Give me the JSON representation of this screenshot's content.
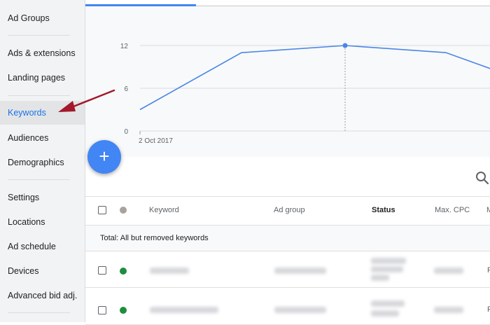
{
  "sidebar": {
    "items": [
      {
        "label": "Ad Groups",
        "active": false
      },
      {
        "label": "Ads & extensions",
        "active": false
      },
      {
        "label": "Landing pages",
        "active": false
      },
      {
        "label": "Keywords",
        "active": true
      },
      {
        "label": "Audiences",
        "active": false
      },
      {
        "label": "Demographics",
        "active": false
      },
      {
        "label": "Settings",
        "active": false
      },
      {
        "label": "Locations",
        "active": false
      },
      {
        "label": "Ad schedule",
        "active": false
      },
      {
        "label": "Devices",
        "active": false
      },
      {
        "label": "Advanced bid adj.",
        "active": false
      }
    ]
  },
  "chart_data": {
    "type": "line",
    "x": [
      "2 Oct 2017",
      "",
      "",
      "",
      ""
    ],
    "x_tick_labels": [
      "2 Oct 2017"
    ],
    "values": [
      3,
      11,
      12,
      11,
      8
    ],
    "y_ticks": [
      0,
      6,
      12
    ],
    "ylim": [
      0,
      14.5
    ],
    "highlighted_index": 2,
    "grid": true,
    "color": "#4a86e8"
  },
  "fab": {
    "label": "+"
  },
  "table": {
    "headers": {
      "keyword": "Keyword",
      "ad_group": "Ad group",
      "status": "Status",
      "max_cpc": "Max. CPC",
      "cut": "M"
    },
    "total_label": "Total: All but removed keywords",
    "rows": [
      {
        "status_color": "#1e8e3e",
        "cut": "P"
      },
      {
        "status_color": "#1e8e3e",
        "cut": "P"
      }
    ]
  },
  "colors": {
    "accent": "#4285f4",
    "active_text": "#1a73e8",
    "annotation_arrow": "#a3182a"
  },
  "icons": {
    "search": "search-icon",
    "add": "plus-icon"
  }
}
